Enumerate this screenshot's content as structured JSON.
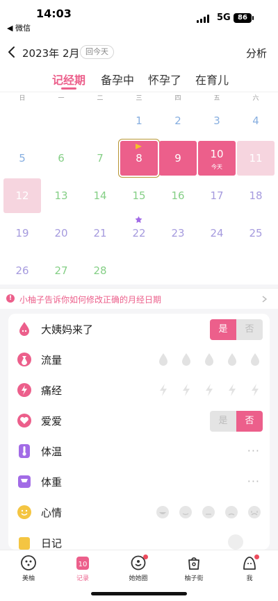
{
  "status_bar": {
    "time": "14:03",
    "back_app": "◀ 微信",
    "network": "5G",
    "battery": "86"
  },
  "header": {
    "title": "2023年 2月",
    "today_button": "回今天",
    "analysis": "分析"
  },
  "mode_tabs": [
    {
      "label": "记经期",
      "active": true
    },
    {
      "label": "备孕中",
      "active": false
    },
    {
      "label": "怀孕了",
      "active": false
    },
    {
      "label": "在育儿",
      "active": false
    }
  ],
  "weekdays": [
    "日",
    "一",
    "二",
    "三",
    "四",
    "五",
    "六"
  ],
  "calendar": {
    "days": [
      {
        "day": "1",
        "color": "blue"
      },
      {
        "day": "2",
        "color": "blue"
      },
      {
        "day": "3",
        "color": "blue"
      },
      {
        "day": "4",
        "color": "blue"
      },
      {
        "day": "5",
        "color": "blue"
      },
      {
        "day": "6",
        "color": "green"
      },
      {
        "day": "7",
        "color": "green"
      },
      {
        "day": "8",
        "color": "period",
        "selected": true,
        "flag": true
      },
      {
        "day": "9",
        "color": "period"
      },
      {
        "day": "10",
        "color": "period",
        "sub": "今天"
      },
      {
        "day": "11",
        "color": "period-light"
      },
      {
        "day": "12",
        "color": "period-light"
      },
      {
        "day": "13",
        "color": "green"
      },
      {
        "day": "14",
        "color": "green"
      },
      {
        "day": "15",
        "color": "green"
      },
      {
        "day": "16",
        "color": "green"
      },
      {
        "day": "17",
        "color": "purple"
      },
      {
        "day": "18",
        "color": "purple"
      },
      {
        "day": "19",
        "color": "purple"
      },
      {
        "day": "20",
        "color": "purple"
      },
      {
        "day": "21",
        "color": "purple"
      },
      {
        "day": "22",
        "color": "purple",
        "ovulation": true
      },
      {
        "day": "23",
        "color": "purple"
      },
      {
        "day": "24",
        "color": "purple"
      },
      {
        "day": "25",
        "color": "purple"
      },
      {
        "day": "26",
        "color": "purple"
      },
      {
        "day": "27",
        "color": "green"
      },
      {
        "day": "28",
        "color": "green"
      }
    ]
  },
  "tip": {
    "text": "小柚子告诉你如何修改正确的月经日期"
  },
  "records": [
    {
      "label": "大姨妈来了",
      "icon": "drop-face-icon",
      "yes": "是",
      "no": "否",
      "value": "yes"
    },
    {
      "label": "流量",
      "icon": "flow-bag-icon"
    },
    {
      "label": "痛经",
      "icon": "pain-bolt-icon"
    },
    {
      "label": "爱爱",
      "icon": "heart-icon",
      "yes": "是",
      "no": "否",
      "value": "no"
    },
    {
      "label": "体温",
      "icon": "thermometer-icon",
      "more": "···"
    },
    {
      "label": "体重",
      "icon": "weight-scale-icon",
      "more": "···"
    },
    {
      "label": "心情",
      "icon": "mood-face-icon"
    },
    {
      "label": "日记",
      "icon": "diary-icon"
    }
  ],
  "tabbar": [
    {
      "label": "美柚",
      "icon": "meiyou-icon"
    },
    {
      "label": "记录",
      "icon": "calendar-10-icon",
      "badge_text": "10",
      "active": true
    },
    {
      "label": "她她圈",
      "icon": "community-icon",
      "dot": true
    },
    {
      "label": "柚子街",
      "icon": "shopping-bag-icon"
    },
    {
      "label": "我",
      "icon": "profile-icon",
      "dot": true
    }
  ],
  "colors": {
    "accent": "#ec5f8b",
    "period_light": "#f6d5df",
    "green": "#85cf86",
    "blue": "#86aee0",
    "purple": "#a59ade"
  }
}
